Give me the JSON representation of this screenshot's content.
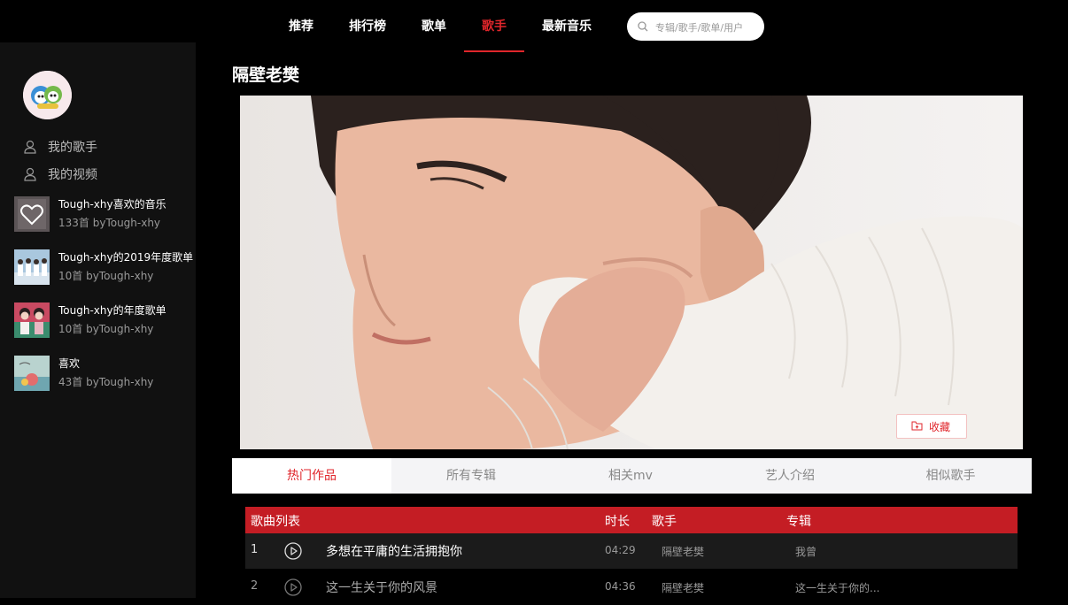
{
  "nav": {
    "items": [
      {
        "label": "推荐"
      },
      {
        "label": "排行榜"
      },
      {
        "label": "歌单"
      },
      {
        "label": "歌手"
      },
      {
        "label": "最新音乐"
      }
    ],
    "active_index": 3,
    "search_placeholder": "专辑/歌手/歌单/用户"
  },
  "sidebar": {
    "links": [
      {
        "label": "我的歌手",
        "icon": "user-icon"
      },
      {
        "label": "我的视频",
        "icon": "user-icon"
      }
    ],
    "playlists": [
      {
        "name": "Tough-xhy喜欢的音乐",
        "meta": "133首 byTough-xhy"
      },
      {
        "name": "Tough-xhy的2019年度歌单",
        "meta": "10首 byTough-xhy"
      },
      {
        "name": "Tough-xhy的年度歌单",
        "meta": "10首 byTough-xhy"
      },
      {
        "name": "喜欢",
        "meta": "43首 byTough-xhy"
      }
    ]
  },
  "artist": {
    "name": "隔壁老樊",
    "favorite_label": "收藏"
  },
  "tabs": [
    {
      "label": "热门作品"
    },
    {
      "label": "所有专辑"
    },
    {
      "label": "相关mv"
    },
    {
      "label": "艺人介绍"
    },
    {
      "label": "相似歌手"
    }
  ],
  "song_table": {
    "headers": {
      "title": "歌曲列表",
      "duration": "时长",
      "singer": "歌手",
      "album": "专辑"
    },
    "rows": [
      {
        "num": "1",
        "title": "多想在平庸的生活拥抱你",
        "duration": "04:29",
        "singer": "隔壁老樊",
        "album": "我曾"
      },
      {
        "num": "2",
        "title": "这一生关于你的风景",
        "duration": "04:36",
        "singer": "隔壁老樊",
        "album": "这一生关于你的..."
      }
    ]
  },
  "colors": {
    "accent": "#e0262b",
    "table_header": "#c41d24",
    "sidebar": "#111111"
  }
}
